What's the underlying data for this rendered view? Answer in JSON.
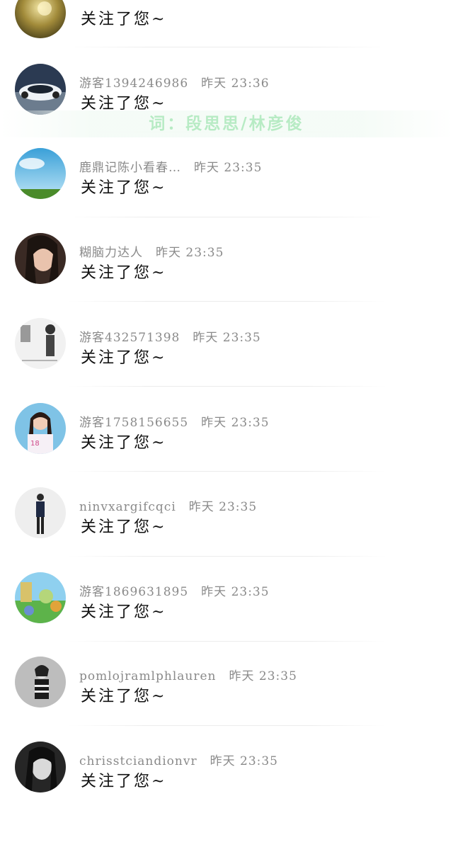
{
  "comments": [
    {
      "user": "",
      "time": "",
      "message": "关注了您~",
      "avatar": "dandelion"
    },
    {
      "user": "游客1394246986",
      "time": "昨天 23:36",
      "message": "关注了您~",
      "avatar": "concept-car"
    },
    {
      "user": "鹿鼎记陈小看春…",
      "time": "昨天 23:35",
      "message": "关注了您~",
      "avatar": "sky-field"
    },
    {
      "user": "糊脑力达人",
      "time": "昨天 23:35",
      "message": "关注了您~",
      "avatar": "woman-portrait"
    },
    {
      "user": "游客432571398",
      "time": "昨天 23:35",
      "message": "关注了您~",
      "avatar": "bw-sketch"
    },
    {
      "user": "游客1758156655",
      "time": "昨天 23:35",
      "message": "关注了您~",
      "avatar": "girl-photo"
    },
    {
      "user": "ninvxargifcqci",
      "time": "昨天 23:35",
      "message": "关注了您~",
      "avatar": "man-standing"
    },
    {
      "user": "游客1869631895",
      "time": "昨天 23:35",
      "message": "关注了您~",
      "avatar": "cartoon-scene"
    },
    {
      "user": "pomlojramlphlauren",
      "time": "昨天 23:35",
      "message": "关注了您~",
      "avatar": "bw-portrait"
    },
    {
      "user": "chrisstciandionvr",
      "time": "昨天 23:35",
      "message": "关注了您~",
      "avatar": "woman-bw"
    }
  ],
  "watermark": "词：段思思/林彦俊",
  "colors": {
    "username": "#8a8a8a",
    "message": "#111111",
    "watermark": "#b7ebc4",
    "divider": "#ececec"
  }
}
